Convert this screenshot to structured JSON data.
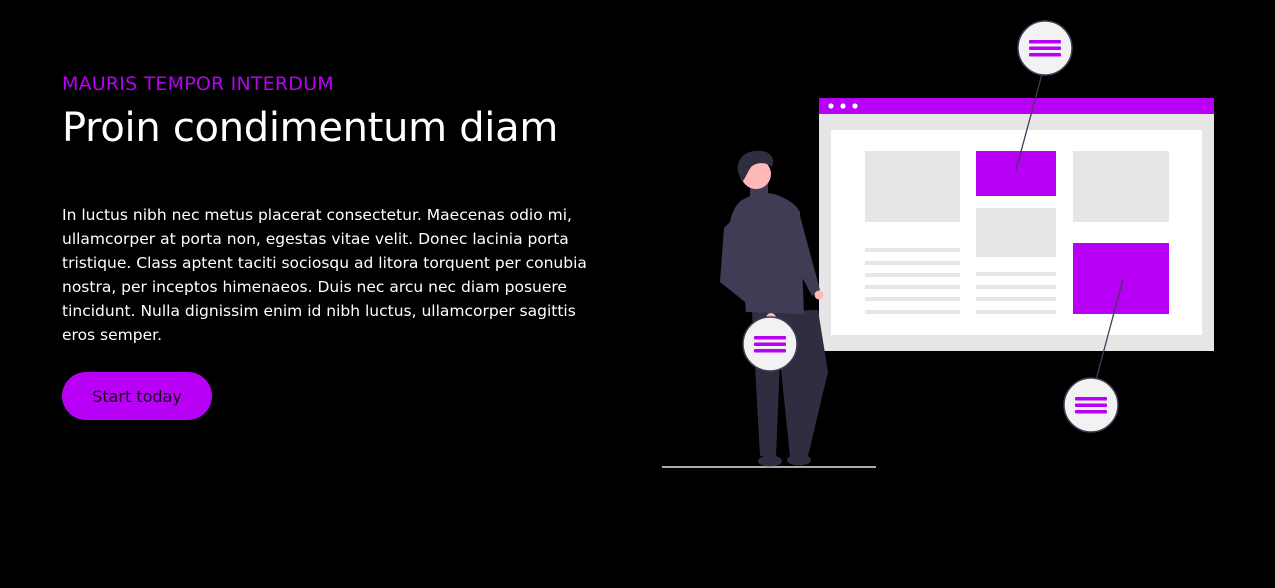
{
  "hero": {
    "eyebrow": "MAURIS TEMPOR INTERDUM",
    "title": "Proin condimentum diam",
    "body": "In luctus nibh nec metus placerat consectetur. Maecenas odio mi, ullamcorper at porta non, egestas vitae velit. Donec lacinia porta tristique. Class aptent taciti sociosqu ad litora torquent per conubia nostra, per inceptos himenaeos. Duis nec arcu nec diam posuere tincidunt. Nulla dignissim enim id nibh luctus, ullamcorper sagittis eros semper.",
    "cta_label": "Start today"
  },
  "illustration": {
    "icons": [
      "menu-icon",
      "menu-icon",
      "menu-icon"
    ],
    "colors": {
      "accent": "#b700f5",
      "background": "#000000",
      "panel": "#e6e6e6",
      "figure": "#3f3d56"
    }
  }
}
